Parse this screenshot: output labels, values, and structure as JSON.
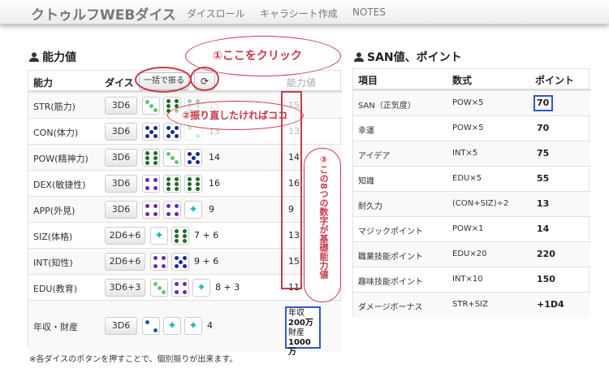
{
  "navbar": {
    "brand": "クトゥルフWEBダイス",
    "links": [
      "ダイスロール",
      "キャラシート作成",
      "NOTES"
    ]
  },
  "left": {
    "title": "能力値",
    "headers": {
      "stat": "能力",
      "dice": "ダイス",
      "value": "能力値"
    },
    "roll_all_label": "一括で振る",
    "refresh_icon": "refresh-icon",
    "rows": [
      {
        "name": "STR(筋力)",
        "dice": "3D6",
        "roll": "15",
        "value": "15"
      },
      {
        "name": "CON(体力)",
        "dice": "3D6",
        "roll": "13",
        "value": "13"
      },
      {
        "name": "POW(精神力)",
        "dice": "3D6",
        "roll": "14",
        "value": "14"
      },
      {
        "name": "DEX(敏捷性)",
        "dice": "3D6",
        "roll": "16",
        "value": "16"
      },
      {
        "name": "APP(外見)",
        "dice": "3D6",
        "roll": "9",
        "value": "9"
      },
      {
        "name": "SIZ(体格)",
        "dice": "2D6+6",
        "roll": "7 + 6",
        "value": "13"
      },
      {
        "name": "INT(知性)",
        "dice": "2D6+6",
        "roll": "9 + 6",
        "value": "15"
      },
      {
        "name": "EDU(教育)",
        "dice": "3D6+3",
        "roll": "8 + 3",
        "value": "11"
      },
      {
        "name": "年収・財産",
        "dice": "3D6",
        "roll": "4",
        "value": ""
      }
    ],
    "income": {
      "label1": "年収",
      "value1": "200万",
      "label2": "財産",
      "value2": "1000万"
    },
    "footnote": "※各ダイスのボタンを押すことで、個別振りが出来ます。"
  },
  "right": {
    "title": "SAN値、ポイント",
    "headers": {
      "item": "項目",
      "formula": "数式",
      "point": "ポイント"
    },
    "rows": [
      {
        "item": "SAN（正気度）",
        "formula": "POW×5",
        "point": "70"
      },
      {
        "item": "幸運",
        "formula": "POW×5",
        "point": "70"
      },
      {
        "item": "アイデア",
        "formula": "INT×5",
        "point": "75"
      },
      {
        "item": "知識",
        "formula": "EDU×5",
        "point": "55"
      },
      {
        "item": "耐久力",
        "formula": "(CON+SIZ)÷2",
        "point": "13"
      },
      {
        "item": "マジックポイント",
        "formula": "POW×1",
        "point": "14"
      },
      {
        "item": "職業技能ポイント",
        "formula": "EDU×20",
        "point": "220"
      },
      {
        "item": "趣味技能ポイント",
        "formula": "INT×10",
        "point": "150"
      },
      {
        "item": "ダメージボーナス",
        "formula": "STR+SIZ",
        "point": "+1D4"
      }
    ]
  },
  "annotations": {
    "click_here": "①ここをクリック",
    "reroll": "②振り直したければココ",
    "base_values": "③この8つの数字が基礎能力値"
  },
  "colors": {
    "annotation": "#c8394a",
    "highlight_blue": "#3355cc"
  }
}
